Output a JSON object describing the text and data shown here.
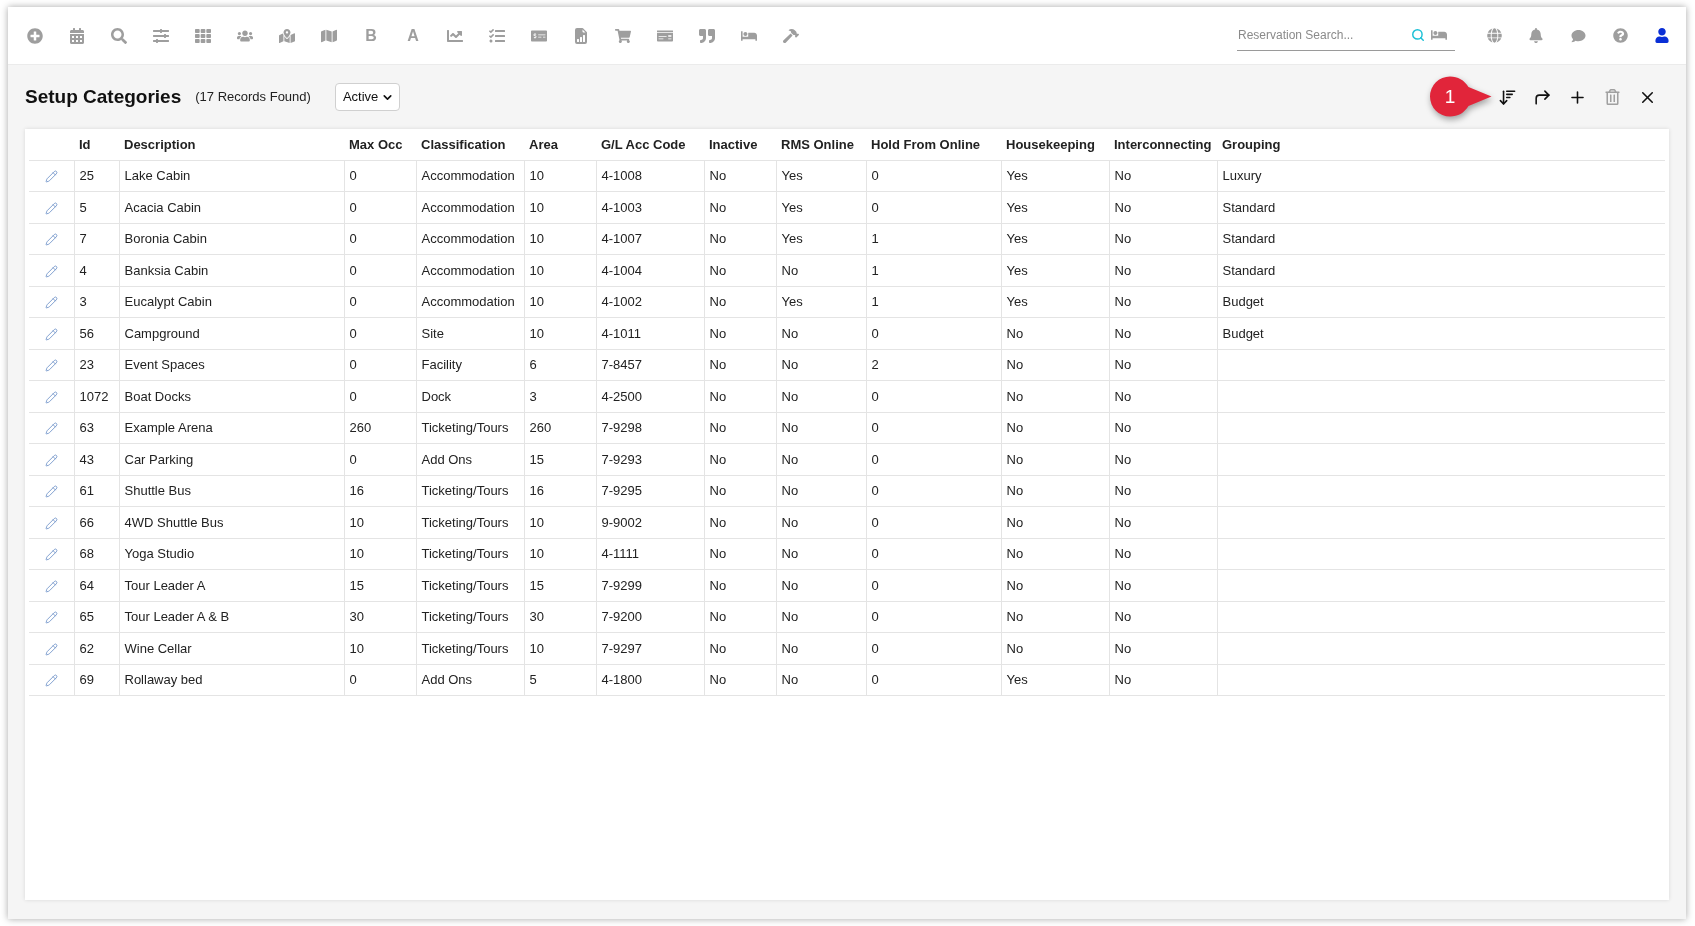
{
  "toolbar": [
    {
      "kind": "add"
    },
    {
      "kind": "calendar"
    },
    {
      "kind": "search"
    },
    {
      "kind": "sliders"
    },
    {
      "kind": "grid"
    },
    {
      "kind": "people"
    },
    {
      "kind": "marker"
    },
    {
      "kind": "map"
    },
    {
      "kind": "letter",
      "glyph": "B"
    },
    {
      "kind": "letter",
      "glyph": "A"
    },
    {
      "kind": "chart"
    },
    {
      "kind": "checklist"
    },
    {
      "kind": "money"
    },
    {
      "kind": "report"
    },
    {
      "kind": "cart"
    },
    {
      "kind": "cheque"
    },
    {
      "kind": "quote"
    },
    {
      "kind": "bed"
    },
    {
      "kind": "hammer"
    }
  ],
  "search": {
    "placeholder": "Reservation Search..."
  },
  "page": {
    "title": "Setup Categories",
    "record_count": "(17 Records Found)",
    "status_filter": {
      "value": "Active"
    }
  },
  "actions": [
    {
      "kind": "sort",
      "disabled": false
    },
    {
      "kind": "redo",
      "disabled": false
    },
    {
      "kind": "add",
      "disabled": false
    },
    {
      "kind": "delete",
      "disabled": true
    },
    {
      "kind": "close",
      "disabled": false
    }
  ],
  "callout": {
    "label": "1"
  },
  "table": {
    "columns": [
      "Id",
      "Description",
      "Max Occ",
      "Classification",
      "Area",
      "G/L Acc Code",
      "Inactive",
      "RMS Online",
      "Hold From Online",
      "Housekeeping",
      "Interconnecting",
      "Grouping"
    ],
    "rows": [
      {
        "cells": [
          "25",
          "Lake Cabin",
          "0",
          "Accommodation",
          "10",
          "4-1008",
          "No",
          "Yes",
          "0",
          "Yes",
          "No",
          "Luxury"
        ]
      },
      {
        "cells": [
          "5",
          "Acacia Cabin",
          "0",
          "Accommodation",
          "10",
          "4-1003",
          "No",
          "Yes",
          "0",
          "Yes",
          "No",
          "Standard"
        ]
      },
      {
        "cells": [
          "7",
          "Boronia Cabin",
          "0",
          "Accommodation",
          "10",
          "4-1007",
          "No",
          "Yes",
          "1",
          "Yes",
          "No",
          "Standard"
        ]
      },
      {
        "cells": [
          "4",
          "Banksia Cabin",
          "0",
          "Accommodation",
          "10",
          "4-1004",
          "No",
          "No",
          "1",
          "Yes",
          "No",
          "Standard"
        ]
      },
      {
        "cells": [
          "3",
          "Eucalypt Cabin",
          "0",
          "Accommodation",
          "10",
          "4-1002",
          "No",
          "Yes",
          "1",
          "Yes",
          "No",
          "Budget"
        ]
      },
      {
        "cells": [
          "56",
          "Campground",
          "0",
          "Site",
          "10",
          "4-1011",
          "No",
          "No",
          "0",
          "No",
          "No",
          "Budget"
        ]
      },
      {
        "cells": [
          "23",
          "Event Spaces",
          "0",
          "Facility",
          "6",
          "7-8457",
          "No",
          "No",
          "2",
          "No",
          "No"
        ]
      },
      {
        "cells": [
          "1072",
          "Boat Docks",
          "0",
          "Dock",
          "3",
          "4-2500",
          "No",
          "No",
          "0",
          "No",
          "No"
        ]
      },
      {
        "cells": [
          "63",
          "Example Arena",
          "260",
          "Ticketing/Tours",
          "260",
          "7-9298",
          "No",
          "No",
          "0",
          "No",
          "No"
        ]
      },
      {
        "cells": [
          "43",
          "Car Parking",
          "0",
          "Add Ons",
          "15",
          "7-9293",
          "No",
          "No",
          "0",
          "No",
          "No"
        ]
      },
      {
        "cells": [
          "61",
          "Shuttle Bus",
          "16",
          "Ticketing/Tours",
          "16",
          "7-9295",
          "No",
          "No",
          "0",
          "No",
          "No"
        ]
      },
      {
        "cells": [
          "66",
          "4WD Shuttle Bus",
          "10",
          "Ticketing/Tours",
          "10",
          "9-9002",
          "No",
          "No",
          "0",
          "No",
          "No"
        ]
      },
      {
        "cells": [
          "68",
          "Yoga Studio",
          "10",
          "Ticketing/Tours",
          "10",
          "4-1111",
          "No",
          "No",
          "0",
          "No",
          "No"
        ]
      },
      {
        "cells": [
          "64",
          "Tour Leader A",
          "15",
          "Ticketing/Tours",
          "15",
          "7-9299",
          "No",
          "No",
          "0",
          "No",
          "No"
        ]
      },
      {
        "cells": [
          "65",
          "Tour Leader A & B",
          "30",
          "Ticketing/Tours",
          "30",
          "7-9200",
          "No",
          "No",
          "0",
          "No",
          "No"
        ]
      },
      {
        "cells": [
          "62",
          "Wine Cellar",
          "10",
          "Ticketing/Tours",
          "10",
          "7-9297",
          "No",
          "No",
          "0",
          "No",
          "No"
        ]
      },
      {
        "cells": [
          "69",
          "Rollaway bed",
          "0",
          "Add Ons",
          "5",
          "4-1800",
          "No",
          "No",
          "0",
          "Yes",
          "No"
        ]
      }
    ]
  }
}
